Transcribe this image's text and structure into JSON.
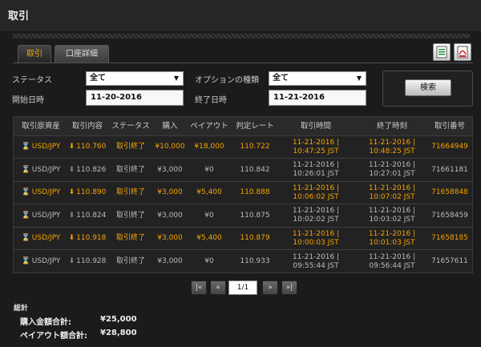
{
  "title": "取引",
  "tabs": [
    {
      "label": "取引"
    },
    {
      "label": "口座詳細"
    }
  ],
  "filters": {
    "status_label": "ステータス",
    "status_value": "全て",
    "option_type_label": "オプションの種類",
    "option_type_value": "全て",
    "start_label": "開始日時",
    "start_value": "11-20-2016",
    "end_label": "終了日時",
    "end_value": "11-21-2016",
    "search_label": "検索"
  },
  "table": {
    "headers": [
      "取引原資産",
      "取引内容",
      "ステータス",
      "購入",
      "ペイアウト",
      "判定レート",
      "取引時間",
      "終了時刻",
      "取引番号"
    ],
    "rows": [
      {
        "asset": "USD/JPY",
        "content": "110.760",
        "status": "取引終了",
        "purchase": "¥10,000",
        "payout": "¥18,000",
        "rate": "110.722",
        "trade_time_1": "11-21-2016 |",
        "trade_time_2": "10:47:25 JST",
        "end_time_1": "11-21-2016 |",
        "end_time_2": "10:48:25 JST",
        "id": "71664949",
        "win": true
      },
      {
        "asset": "USD/JPY",
        "content": "110.826",
        "status": "取引終了",
        "purchase": "¥3,000",
        "payout": "¥0",
        "rate": "110.842",
        "trade_time_1": "11-21-2016 |",
        "trade_time_2": "10:26:01 JST",
        "end_time_1": "11-21-2016 |",
        "end_time_2": "10:27:01 JST",
        "id": "71661181",
        "win": false
      },
      {
        "asset": "USD/JPY",
        "content": "110.890",
        "status": "取引終了",
        "purchase": "¥3,000",
        "payout": "¥5,400",
        "rate": "110.888",
        "trade_time_1": "11-21-2016 |",
        "trade_time_2": "10:06:02 JST",
        "end_time_1": "11-21-2016 |",
        "end_time_2": "10:07:02 JST",
        "id": "71658848",
        "win": true
      },
      {
        "asset": "USD/JPY",
        "content": "110.824",
        "status": "取引終了",
        "purchase": "¥3,000",
        "payout": "¥0",
        "rate": "110.875",
        "trade_time_1": "11-21-2016 |",
        "trade_time_2": "10:02:02 JST",
        "end_time_1": "11-21-2016 |",
        "end_time_2": "10:03:02 JST",
        "id": "71658459",
        "win": false
      },
      {
        "asset": "USD/JPY",
        "content": "110.918",
        "status": "取引終了",
        "purchase": "¥3,000",
        "payout": "¥5,400",
        "rate": "110.879",
        "trade_time_1": "11-21-2016 |",
        "trade_time_2": "10:00:03 JST",
        "end_time_1": "11-21-2016 |",
        "end_time_2": "10:01:03 JST",
        "id": "71658185",
        "win": true
      },
      {
        "asset": "USD/JPY",
        "content": "110.928",
        "status": "取引終了",
        "purchase": "¥3,000",
        "payout": "¥0",
        "rate": "110.933",
        "trade_time_1": "11-21-2016 |",
        "trade_time_2": "09:55:44 JST",
        "end_time_1": "11-21-2016 |",
        "end_time_2": "09:56:44 JST",
        "id": "71657611",
        "win": false
      }
    ]
  },
  "pagination": {
    "first": "|«",
    "prev": "«",
    "page": "1/1",
    "next": "»",
    "last": "»|"
  },
  "summary": {
    "title": "総計",
    "purchase_label": "購入金額合計:",
    "purchase_value": "¥25,000",
    "payout_label": "ペイアウト額合計:",
    "payout_value": "¥28,800"
  },
  "colors": {
    "accent": "#f4a300",
    "background": "#1b1b1b"
  },
  "icons": [
    "hourglass-icon",
    "arrow-down-icon",
    "excel-export-icon",
    "pdf-export-icon"
  ]
}
